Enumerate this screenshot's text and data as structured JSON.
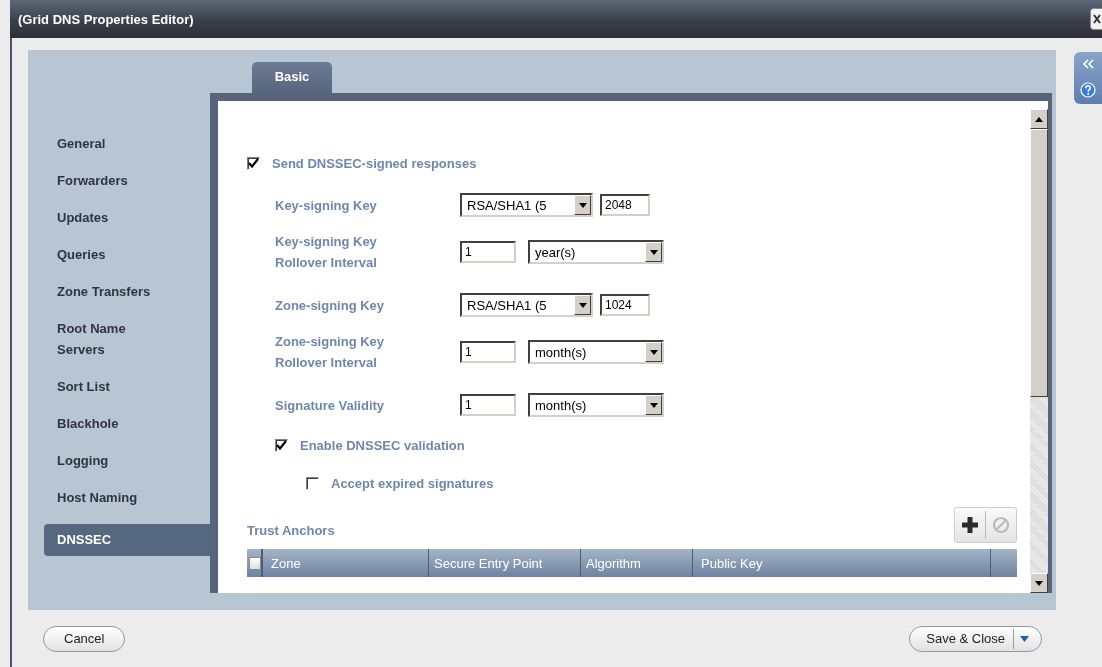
{
  "window": {
    "title": "(Grid DNS Properties Editor)"
  },
  "sidebar": {
    "items": [
      {
        "label": "General",
        "selected": false
      },
      {
        "label": "Forwarders",
        "selected": false
      },
      {
        "label": "Updates",
        "selected": false
      },
      {
        "label": "Queries",
        "selected": false
      },
      {
        "label": "Zone Transfers",
        "selected": false
      },
      {
        "label": "Root Name Servers",
        "selected": false
      },
      {
        "label": "Sort List",
        "selected": false
      },
      {
        "label": "Blackhole",
        "selected": false
      },
      {
        "label": "Logging",
        "selected": false
      },
      {
        "label": "Host Naming",
        "selected": false
      },
      {
        "label": "DNSSEC",
        "selected": true
      }
    ]
  },
  "tabs": [
    {
      "label": "Basic",
      "selected": true
    }
  ],
  "send_signed": {
    "label": "Send DNSSEC-signed responses",
    "checked": true
  },
  "fields": [
    {
      "kind": "algorithm",
      "label": "Key-signing Key",
      "algorithm": "RSA/SHA1 (5",
      "size": "2048"
    },
    {
      "kind": "interval",
      "label": "Key-signing Key Rollover Interval",
      "number": "1",
      "unit": "year(s)"
    },
    {
      "kind": "algorithm",
      "label": "Zone-signing Key",
      "algorithm": "RSA/SHA1 (5",
      "size": "1024"
    },
    {
      "kind": "interval",
      "label": "Zone-signing Key Rollover Interval",
      "number": "1",
      "unit": "month(s)"
    },
    {
      "kind": "interval",
      "label": "Signature Validity",
      "number": "1",
      "unit": "month(s)"
    }
  ],
  "options": [
    {
      "label": "Enable DNSSEC validation",
      "checked": true,
      "children": [
        {
          "label": "Accept expired signatures",
          "checked": false
        }
      ]
    }
  ],
  "trust_anchors": {
    "title": "Trust Anchors",
    "select_all_checked": false,
    "columns": [
      "Zone",
      "Secure Entry Point",
      "Algorithm",
      "Public Key"
    ]
  },
  "buttons": {
    "cancel": "Cancel",
    "save": "Save & Close"
  }
}
